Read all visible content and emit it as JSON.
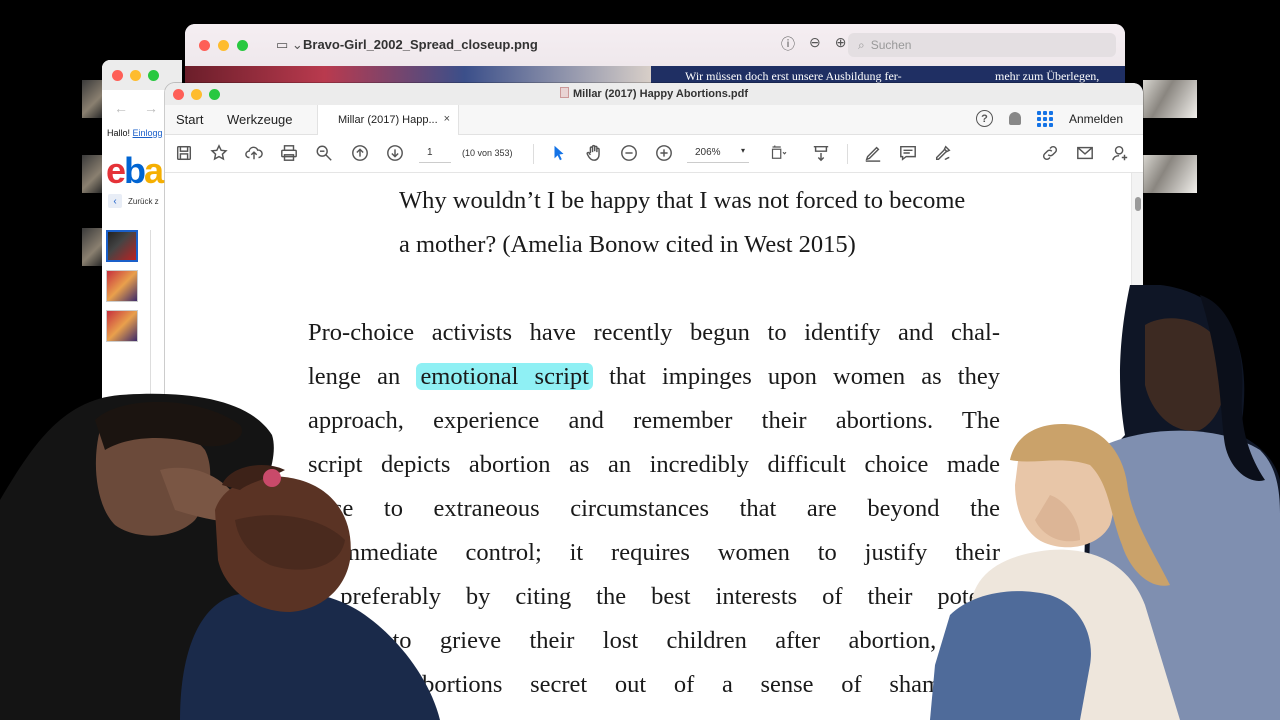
{
  "ebay_window": {
    "greeting": "Hallo!",
    "login_link": "Einlogg",
    "logo": {
      "e": "e",
      "b": "b",
      "a": "a"
    },
    "back_link": "Zurück z"
  },
  "image_viewer": {
    "title": "Bravo-Girl_2002_Spread_closeup.png",
    "search_placeholder": "Suchen",
    "magazine_text_left": "Wir müssen doch erst unsere Ausbildung fer-",
    "magazine_text_right": "mehr zum Überlegen,"
  },
  "pdf_window": {
    "title": "Millar (2017) Happy Abortions.pdf",
    "tabs": {
      "start": "Start",
      "tools": "Werkzeuge",
      "document": "Millar (2017) Happ...",
      "close": "×"
    },
    "help": "?",
    "sign_in": "Anmelden",
    "toolbar": {
      "page_number": "1",
      "page_of": "(10 von 353)",
      "zoom": "206%"
    },
    "document": {
      "quote_lines": [
        "Why wouldn’t I be happy that I was not forced to become",
        "a mother? (Amelia Bonow cited in West 2015)"
      ],
      "para_line1": "Pro-choice activists have recently begun to identify and chal-",
      "para_line2_pre": "lenge an",
      "para_line2_highlight": "emotional script",
      "para_line2_post": "that impinges upon women as they",
      "para_lines_rest": [
        "approach, experience and remember their abortions. The",
        "script depicts abortion as an incredibly difficult choice made",
        "in response to extraneous circumstances that are beyond the",
        "woman’s immediate control; it requires women to justify their",
        "decisions, preferably by citing the best interests of their poten-",
        "tial children, to grieve their lost children after abortion, and",
        "to keep their abortions secret out of a sense of shame or"
      ]
    }
  },
  "colors": {
    "highlight": "#8ff0f4",
    "acrobat_blue": "#1473e6"
  }
}
